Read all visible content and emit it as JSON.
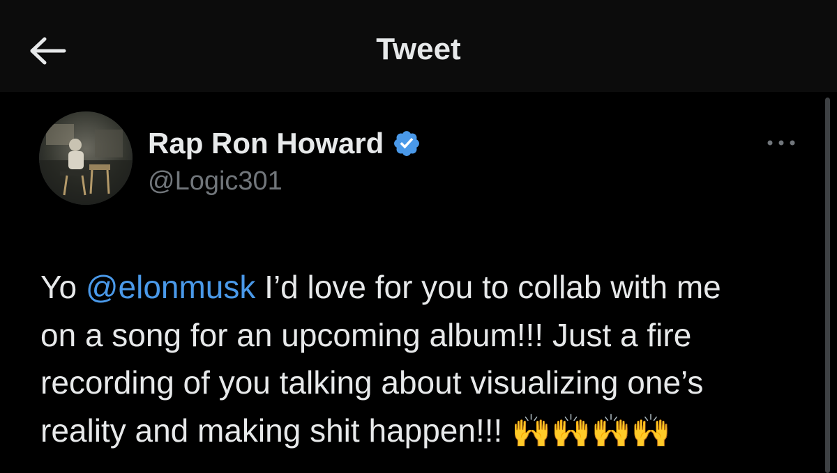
{
  "header": {
    "title": "Tweet",
    "back_icon": "arrow-left-icon"
  },
  "tweet": {
    "author": {
      "display_name": "Rap Ron Howard",
      "handle": "@Logic301",
      "verified": true,
      "verified_color": "#4a99e9"
    },
    "more_icon": "more-horizontal-icon",
    "text": {
      "prefix": "Yo ",
      "mention": "@elonmusk",
      "line1_rest": " I’d love for you to collab with me",
      "line2": "on a song for an upcoming album!!! Just a fire",
      "line3": "recording of you talking about visualizing one’s",
      "line4": "reality and making shit happen!!! ",
      "emoji": "🙌🙌🙌🙌"
    }
  },
  "colors": {
    "background": "#000000",
    "header_background": "#0c0c0c",
    "text_primary": "#e7e9ea",
    "text_secondary": "#71767b",
    "link": "#4a99e9"
  }
}
